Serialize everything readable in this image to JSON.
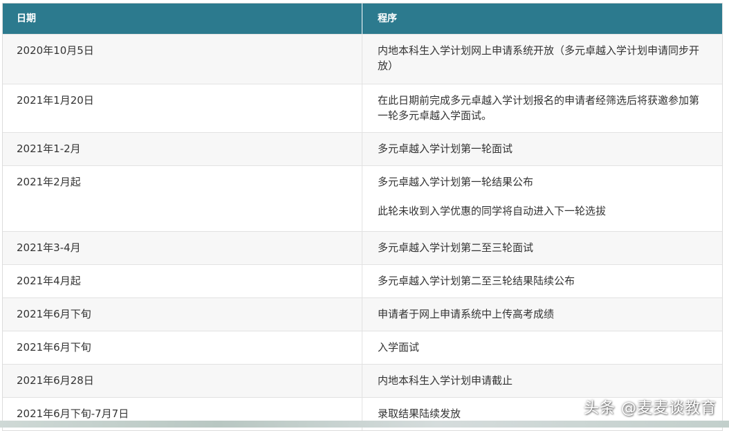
{
  "table": {
    "headers": {
      "date": "日期",
      "procedure": "程序"
    },
    "rows": [
      {
        "date": "2020年10月5日",
        "procedure": "内地本科生入学计划网上申请系统开放（多元卓越入学计划申请同步开放）"
      },
      {
        "date": "2021年1月20日",
        "procedure": "在此日期前完成多元卓越入学计划报名的申请者经筛选后将获邀参加第一轮多元卓越入学面试。"
      },
      {
        "date": "2021年1-2月",
        "procedure": "多元卓越入学计划第一轮面试"
      },
      {
        "date": "2021年2月起",
        "procedure": "多元卓越入学计划第一轮结果公布",
        "procedure_note": "此轮未收到入学优惠的同学将自动进入下一轮选拔"
      },
      {
        "date": "2021年3-4月",
        "procedure": "多元卓越入学计划第二至三轮面试"
      },
      {
        "date": "2021年4月起",
        "procedure": "多元卓越入学计划第二至三轮结果陆续公布"
      },
      {
        "date": "2021年6月下旬",
        "procedure": "申请者于网上申请系统中上传高考成绩"
      },
      {
        "date": "2021年6月下旬",
        "procedure": "入学面试"
      },
      {
        "date": "2021年6月28日",
        "procedure": "内地本科生入学计划申请截止"
      },
      {
        "date": "2021年6月下旬-7月7日",
        "procedure": "录取结果陆续发放"
      }
    ]
  },
  "watermark": "头条 @麦麦谈教育",
  "colors": {
    "header_bg": "#2c7a8e",
    "row_alt": "#f7f7f7",
    "row_plain": "#ffffff",
    "text": "#333333"
  }
}
